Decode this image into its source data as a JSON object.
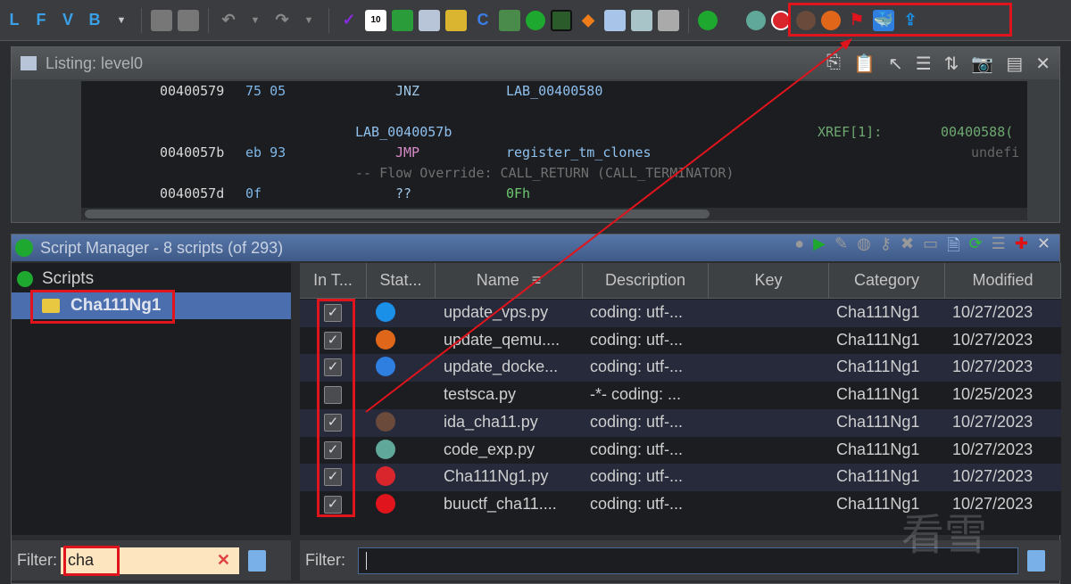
{
  "toolbar": {
    "left_letters": [
      "L",
      "F",
      "V",
      "B"
    ],
    "icons": [
      "undo-icon",
      "redo-icon",
      "check-icon",
      "bytes-icon",
      "export-icon",
      "listing-icon",
      "datatype-icon",
      "decompiler-icon",
      "function-graph-icon",
      "run-icon",
      "memory-icon",
      "diamond-icon",
      "table-icon",
      "table-export-icon",
      "tree-icon",
      "run-script-icon"
    ],
    "custom_script_icons": [
      "chatgpt-icon",
      "cha111ng1-icon",
      "ida-icon",
      "qemu-icon",
      "buuctf-flag-icon",
      "docker-icon",
      "upload-icon"
    ]
  },
  "listing": {
    "title": "Listing:  level0",
    "lines": [
      {
        "addr": "00400579",
        "bytes": "75 05",
        "mnemonic": "JNZ",
        "operand": "LAB_00400580"
      },
      {
        "label": "LAB_0040057b",
        "xref": "XREF[1]:",
        "xref_addr": "00400588("
      },
      {
        "addr": "0040057b",
        "bytes": "eb 93",
        "mnemonic": "JMP",
        "operand": "register_tm_clones",
        "extra": "undefi"
      },
      {
        "comment": "-- Flow Override: CALL_RETURN (CALL_TERMINATOR)"
      },
      {
        "addr": "0040057d",
        "bytes": "0f",
        "mnemonic": "??",
        "operand": "0Fh"
      }
    ]
  },
  "script_manager": {
    "title": "Script Manager - 8 scripts  (of 293)",
    "tree": {
      "root": "Scripts",
      "selected": "Cha111Ng1"
    },
    "columns": [
      "In T...",
      "Stat...",
      "Name",
      "Description",
      "Key",
      "Category",
      "Modified"
    ],
    "rows": [
      {
        "in_toolbar": true,
        "icon": "upload-icon",
        "name": "update_vps.py",
        "description": "coding: utf-...",
        "key": "",
        "category": "Cha111Ng1",
        "modified": "10/27/2023"
      },
      {
        "in_toolbar": true,
        "icon": "qemu-icon",
        "name": "update_qemu....",
        "description": "coding: utf-...",
        "key": "",
        "category": "Cha111Ng1",
        "modified": "10/27/2023"
      },
      {
        "in_toolbar": true,
        "icon": "docker-icon",
        "name": "update_docke...",
        "description": "coding: utf-...",
        "key": "",
        "category": "Cha111Ng1",
        "modified": "10/27/2023"
      },
      {
        "in_toolbar": false,
        "icon": "",
        "name": "testsca.py",
        "description": "-*- coding: ...",
        "key": "",
        "category": "Cha111Ng1",
        "modified": "10/25/2023"
      },
      {
        "in_toolbar": true,
        "icon": "ida-icon",
        "name": "ida_cha11.py",
        "description": "coding: utf-...",
        "key": "",
        "category": "Cha111Ng1",
        "modified": "10/27/2023"
      },
      {
        "in_toolbar": true,
        "icon": "chatgpt-icon",
        "name": "code_exp.py",
        "description": "coding: utf-...",
        "key": "",
        "category": "Cha111Ng1",
        "modified": "10/27/2023"
      },
      {
        "in_toolbar": true,
        "icon": "cha111ng1-icon",
        "name": "Cha111Ng1.py",
        "description": "coding: utf-...",
        "key": "",
        "category": "Cha111Ng1",
        "modified": "10/27/2023"
      },
      {
        "in_toolbar": true,
        "icon": "buuctf-flag-icon",
        "name": "buuctf_cha11....",
        "description": "coding: utf-...",
        "key": "",
        "category": "Cha111Ng1",
        "modified": "10/27/2023"
      }
    ],
    "tree_filter": {
      "label": "Filter:",
      "value": "cha"
    },
    "table_filter": {
      "label": "Filter:",
      "value": ""
    }
  },
  "watermark": "看雪",
  "colors": {
    "annotation": "#e0141c",
    "selection": "#4b6eaf",
    "filter_bg": "#fde5c0"
  }
}
